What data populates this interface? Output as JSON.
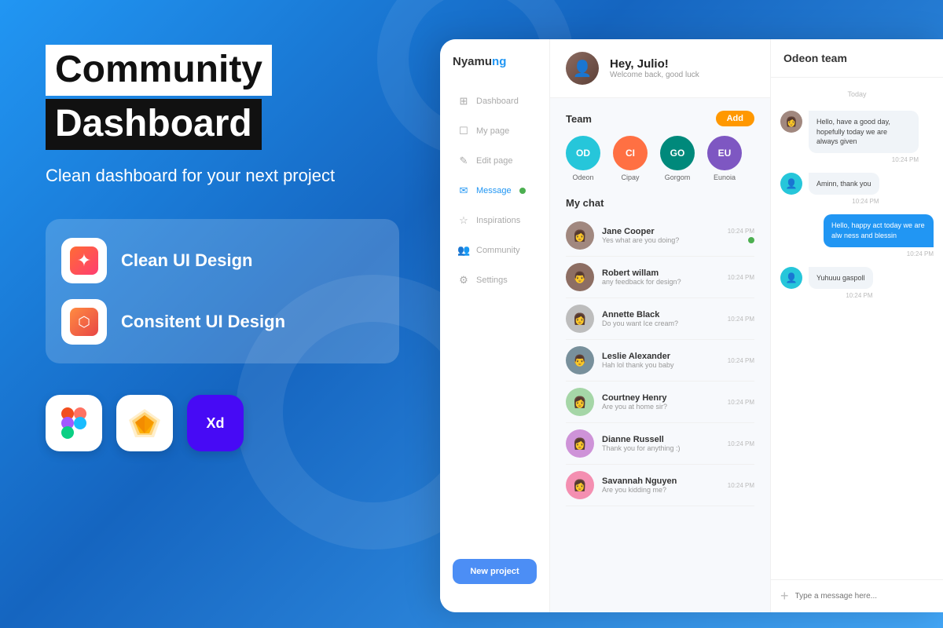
{
  "background": {
    "gradient_start": "#2196F3",
    "gradient_end": "#1565C0"
  },
  "left": {
    "title_line1": "Community",
    "title_line2": "Dashboard",
    "subtitle": "Clean dashboard for your next project",
    "features": [
      {
        "label": "Clean UI Design",
        "icon": "spark"
      },
      {
        "label": "Consitent UI Design",
        "icon": "layers"
      }
    ],
    "tools": [
      {
        "name": "figma",
        "emoji": "🅕"
      },
      {
        "name": "sketch",
        "emoji": "💎"
      },
      {
        "name": "xd",
        "emoji": "🅧"
      }
    ]
  },
  "sidebar": {
    "logo": "Nyamu",
    "logo_highlight": "ng",
    "nav_items": [
      {
        "label": "Dashboard",
        "icon": "⊞",
        "active": false
      },
      {
        "label": "My page",
        "icon": "☐",
        "active": false
      },
      {
        "label": "Edit page",
        "icon": "✎",
        "active": false
      },
      {
        "label": "Message",
        "icon": "✉",
        "active": true,
        "badge": true
      },
      {
        "label": "Inspirations",
        "icon": "☆",
        "active": false
      },
      {
        "label": "Community",
        "icon": "👥",
        "active": false
      },
      {
        "label": "Settings",
        "icon": "⚙",
        "active": false
      }
    ],
    "new_project_label": "New project"
  },
  "header": {
    "greeting": "Hey, Julio!",
    "subtitle": "Welcome back, good luck"
  },
  "team": {
    "section_title": "Team",
    "add_label": "Add",
    "members": [
      {
        "initials": "OD",
        "name": "Odeon",
        "color": "#26C6DA"
      },
      {
        "initials": "CI",
        "name": "Cipay",
        "color": "#FF7043"
      },
      {
        "initials": "GO",
        "name": "Gorgom",
        "color": "#00897B"
      },
      {
        "initials": "EU",
        "name": "Eunoia",
        "color": "#7E57C2"
      }
    ]
  },
  "chat": {
    "section_title": "My chat",
    "items": [
      {
        "name": "Jane Cooper",
        "preview": "Yes what are you doing?",
        "time": "10:24 PM",
        "online": true,
        "color": "#6D4C41"
      },
      {
        "name": "Robert willam",
        "preview": "any feedback for design?",
        "time": "10:24 PM",
        "online": false,
        "color": "#5D4037"
      },
      {
        "name": "Annette Black",
        "preview": "Do you want Ice cream?",
        "time": "10:24 PM",
        "online": false,
        "color": "#8D6E63"
      },
      {
        "name": "Leslie Alexander",
        "preview": "Hah lol thank you baby",
        "time": "10:24 PM",
        "online": false,
        "color": "#795548"
      },
      {
        "name": "Courtney Henry",
        "preview": "Are you at home sir?",
        "time": "10:24 PM",
        "online": false,
        "color": "#A1887F"
      },
      {
        "name": "Dianne Russell",
        "preview": "Thank you for anything :)",
        "time": "10:24 PM",
        "online": false,
        "color": "#6D4C41"
      },
      {
        "name": "Savannah Nguyen",
        "preview": "Are you kidding me?",
        "time": "10:24 PM",
        "online": false,
        "color": "#4E342E"
      }
    ]
  },
  "messages": {
    "title": "Odeon team",
    "day_label": "Today",
    "messages": [
      {
        "type": "received",
        "text": "Hello, have a good day, hopefully today we are always given",
        "time": "10:24 PM"
      },
      {
        "type": "received_simple",
        "text": "Aminn, thank you",
        "time": "10:24 PM"
      },
      {
        "type": "sent",
        "text": "Hello, happy act today we are alw ness and blessin",
        "time": "10:24 PM"
      },
      {
        "type": "received_simple",
        "text": "Yuhuuu gaspoll",
        "time": "10:24 PM"
      }
    ],
    "input_placeholder": "Type a message here..."
  }
}
